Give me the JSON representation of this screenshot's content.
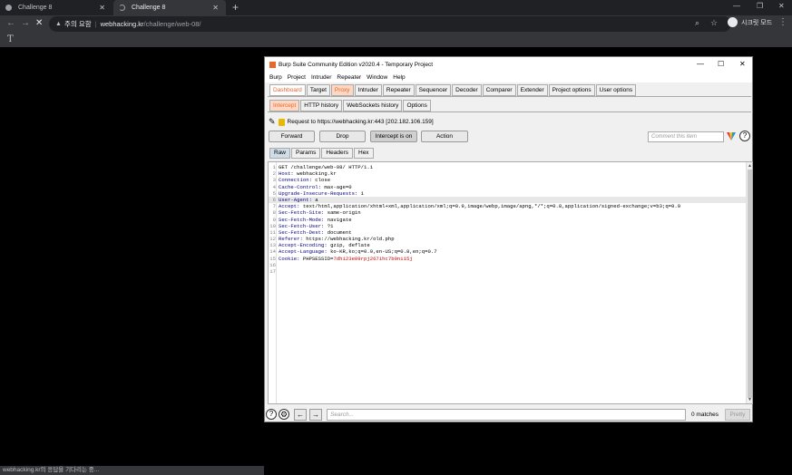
{
  "browser": {
    "tabs": [
      {
        "title": "Challenge 8"
      },
      {
        "title": "Challenge 8"
      }
    ],
    "new_tab_glyph": "+",
    "address": {
      "security_label": "주의 요함",
      "host": "webhacking.kr",
      "path": "/challenge/web-08/"
    },
    "profile_label": "시크릿 모드",
    "bookmark_glyph": "T",
    "status_text": "webhacking.kr의 응답을 기다리는 중..."
  },
  "burp": {
    "title": "Burp Suite Community Edition v2020.4 - Temporary Project",
    "menu": [
      "Burp",
      "Project",
      "Intruder",
      "Repeater",
      "Window",
      "Help"
    ],
    "main_tabs": [
      "Dashboard",
      "Target",
      "Proxy",
      "Intruder",
      "Repeater",
      "Sequencer",
      "Decoder",
      "Comparer",
      "Extender",
      "Project options",
      "User options"
    ],
    "proxy_tabs": [
      "Intercept",
      "HTTP history",
      "WebSockets history",
      "Options"
    ],
    "request_info": "Request to https://webhacking.kr:443  [202.182.106.159]",
    "buttons": {
      "forward": "Forward",
      "drop": "Drop",
      "intercept": "Intercept is on",
      "action": "Action"
    },
    "comment_placeholder": "Comment this item",
    "help_glyph": "?",
    "editor_tabs": [
      "Raw",
      "Params",
      "Headers",
      "Hex"
    ],
    "request_lines": [
      {
        "n": "1",
        "k": "GET /challenge/web-08/ HTTP/1.1",
        "v": ""
      },
      {
        "n": "2",
        "k": "Host:",
        "v": " webhacking.kr"
      },
      {
        "n": "3",
        "k": "Connection:",
        "v": " close"
      },
      {
        "n": "4",
        "k": "Cache-Control:",
        "v": " max-age=0"
      },
      {
        "n": "5",
        "k": "Upgrade-Insecure-Requests:",
        "v": " 1"
      },
      {
        "n": "6",
        "k": "User-Agent:",
        "v": " a"
      },
      {
        "n": "7",
        "k": "Accept:",
        "v": " text/html,application/xhtml+xml,application/xml;q=0.9,image/webp,image/apng,*/*;q=0.8,application/signed-exchange;v=b3;q=0.9"
      },
      {
        "n": "8",
        "k": "Sec-Fetch-Site:",
        "v": " same-origin"
      },
      {
        "n": "9",
        "k": "Sec-Fetch-Mode:",
        "v": " navigate"
      },
      {
        "n": "10",
        "k": "Sec-Fetch-User:",
        "v": " ?1"
      },
      {
        "n": "11",
        "k": "Sec-Fetch-Dest:",
        "v": " document"
      },
      {
        "n": "12",
        "k": "Referer:",
        "v": " https://webhacking.kr/old.php"
      },
      {
        "n": "13",
        "k": "Accept-Encoding:",
        "v": " gzip, deflate"
      },
      {
        "n": "14",
        "k": "Accept-Language:",
        "v": " ko-KR,ko;q=0.9,en-US;q=0.8,en;q=0.7"
      },
      {
        "n": "15",
        "k": "Cookie:",
        "v": " PHPSESSID=",
        "cookie": "7dhi23e09rpj267ihc7b9ni15j"
      },
      {
        "n": "16",
        "k": "",
        "v": ""
      },
      {
        "n": "17",
        "k": "",
        "v": ""
      }
    ],
    "search_placeholder": "Search...",
    "matches_label": "0 matches",
    "pretty_label": "Pretty",
    "colors": {
      "accent": "#e8682b",
      "header_key": "#000080",
      "cookie_value": "#d00000"
    }
  }
}
